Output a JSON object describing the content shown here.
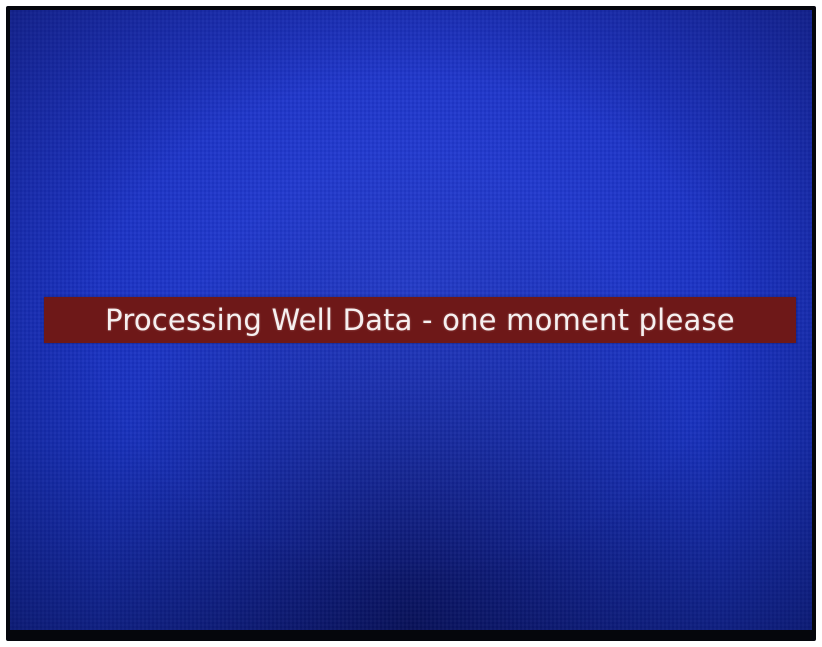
{
  "screen": {
    "background_color": "#1a31c4",
    "banner": {
      "message": "Processing Well Data - one moment please",
      "background_color": "#6e1818",
      "text_color": "#f6f0f0"
    }
  }
}
